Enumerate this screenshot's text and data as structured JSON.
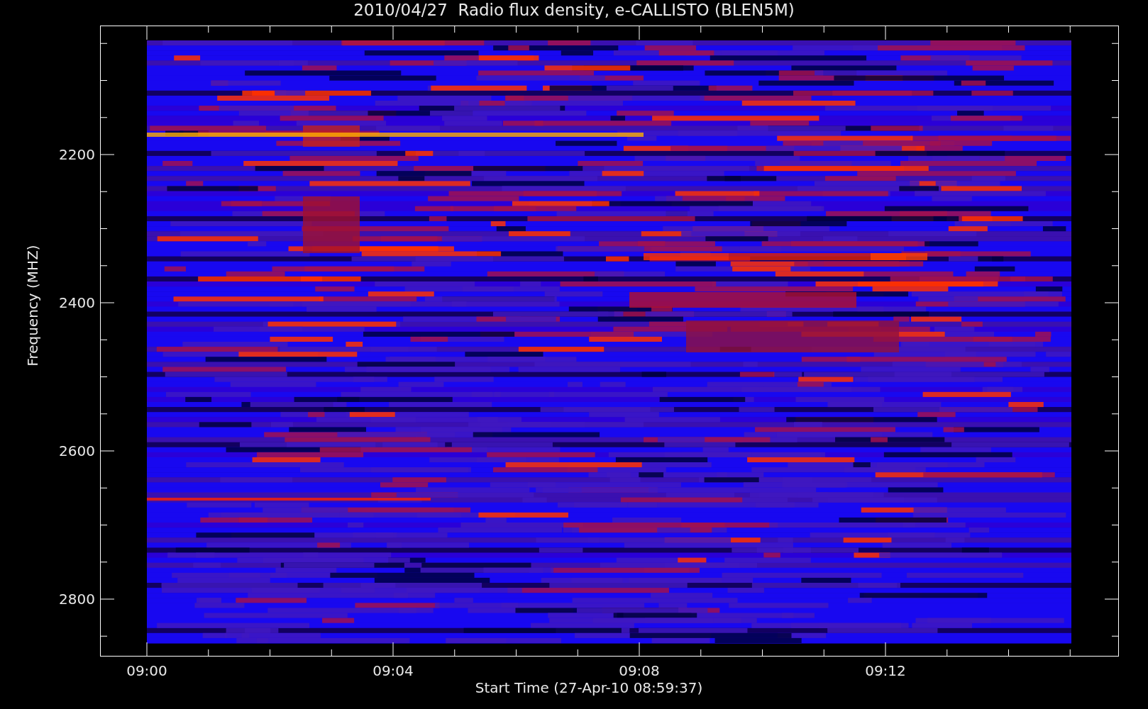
{
  "title": "2010/04/27  Radio flux density, e-CALLISTO (BLEN5M)",
  "y_axis": {
    "label": "Frequency (MHZ)",
    "ticks": [
      "2200",
      "2400",
      "2600",
      "2800"
    ]
  },
  "x_axis": {
    "label": "Start Time (27-Apr-10 08:59:37)",
    "ticks": [
      "09:00",
      "09:04",
      "09:08",
      "09:12"
    ]
  }
}
